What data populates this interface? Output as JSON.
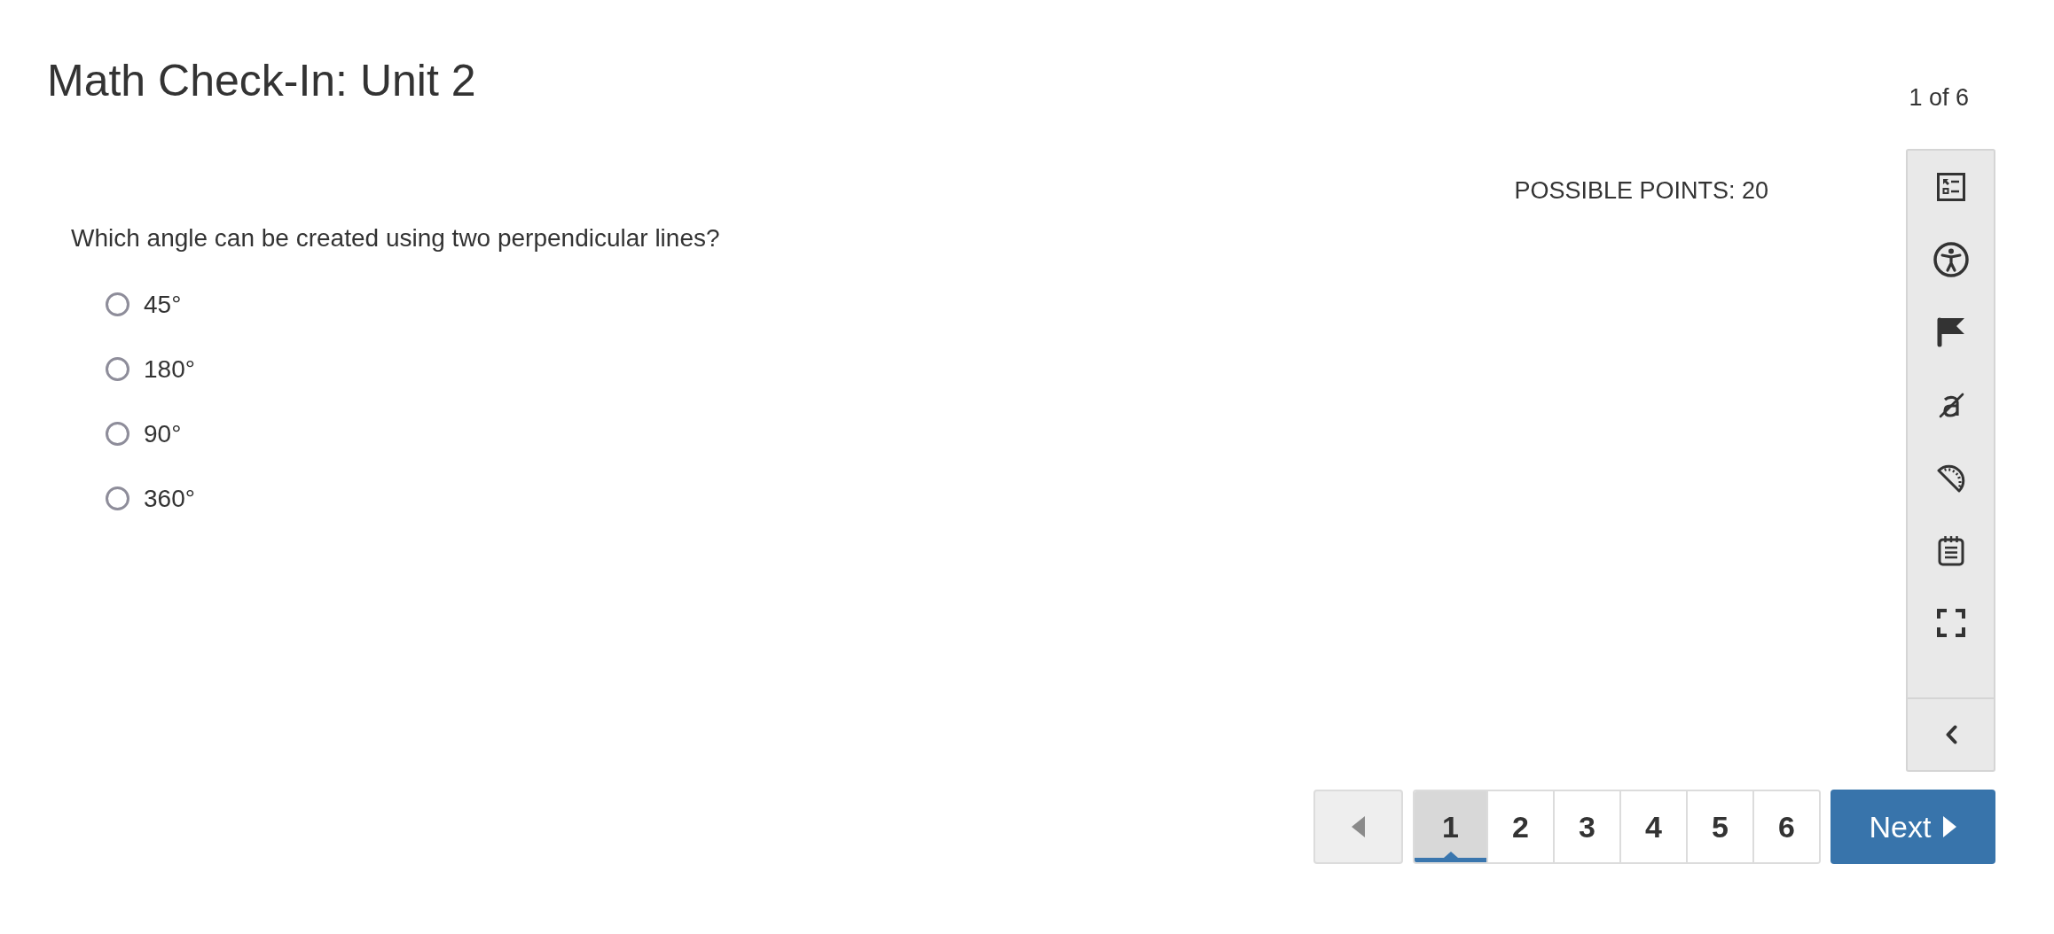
{
  "header": {
    "title": "Math Check-In: Unit 2",
    "progress": "1 of 6"
  },
  "question": {
    "points": "POSSIBLE POINTS: 20",
    "prompt": "Which angle can be created using two perpendicular lines?",
    "options": [
      {
        "label": "45°",
        "selected": false
      },
      {
        "label": "180°",
        "selected": false
      },
      {
        "label": "90°",
        "selected": false
      },
      {
        "label": "360°",
        "selected": false
      }
    ]
  },
  "pagination": {
    "previous": {
      "disabled": true
    },
    "pages": [
      {
        "label": "1",
        "selected": true
      },
      {
        "label": "2",
        "selected": false
      },
      {
        "label": "3",
        "selected": false
      },
      {
        "label": "4",
        "selected": false
      },
      {
        "label": "5",
        "selected": false
      },
      {
        "label": "6",
        "selected": false
      }
    ],
    "next": {
      "label": "Next"
    }
  }
}
